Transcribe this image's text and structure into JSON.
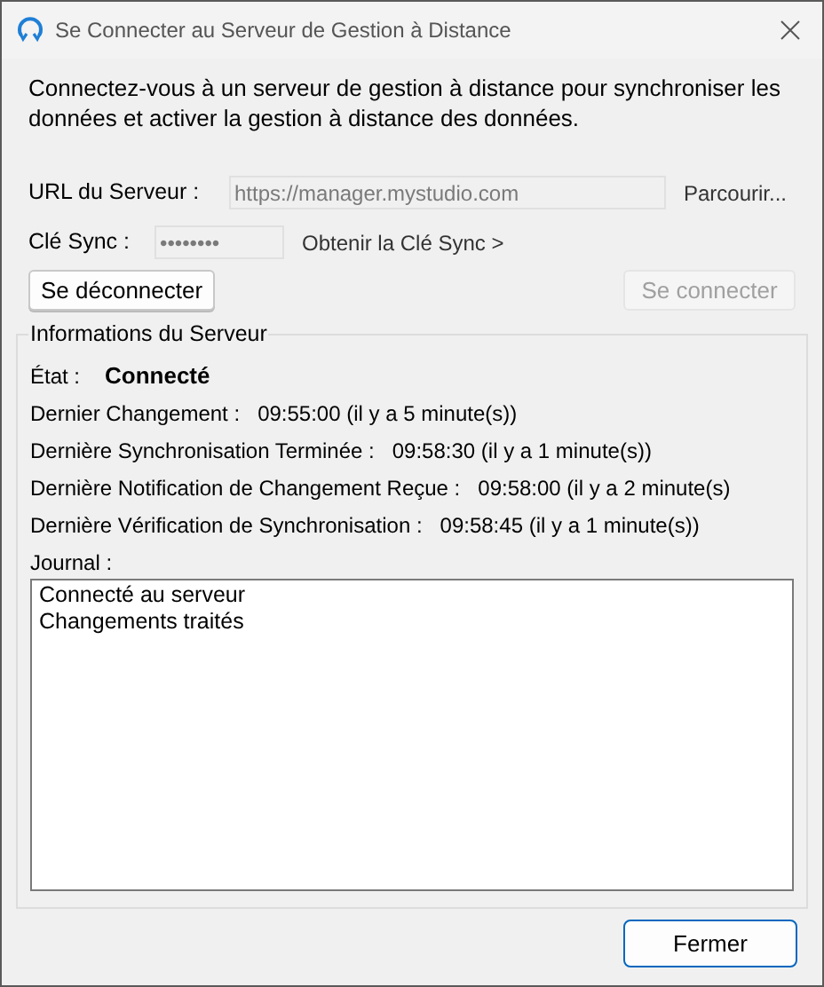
{
  "window": {
    "title": "Se Connecter au Serveur de Gestion à Distance"
  },
  "description": "Connectez-vous à un serveur de gestion à distance pour synchroniser les données et activer la gestion à distance des données.",
  "server_url": {
    "label": "URL du Serveur :",
    "value": "https://manager.mystudio.com",
    "disabled": true
  },
  "browse_link": "Parcourir...",
  "sync_key": {
    "label": "Clé Sync :",
    "value": "••••••••",
    "disabled": true
  },
  "get_key_link": "Obtenir la Clé Sync >",
  "buttons": [
    {
      "label": "Se déconnecter",
      "disabled": false
    },
    {
      "label": "Se connecter",
      "disabled": true
    }
  ],
  "server_info": {
    "title": "Informations du Serveur",
    "status_label": "État :",
    "status": "Connecté",
    "rows": [
      {
        "label": "Dernier Changement :",
        "value": "09:55:00 (il y a 5 minute(s))"
      },
      {
        "label": "Dernière Synchronisation Terminée :",
        "value": "09:58:30 (il y a 1 minute(s))"
      },
      {
        "label": "Dernière Notification de Changement Reçue :",
        "value": "09:58:00 (il y a 2 minute(s)"
      },
      {
        "label": "Dernière Vérification de Synchronisation :",
        "value": "09:58:45 (il y a 1 minute(s))"
      }
    ],
    "log_label": "Journal :",
    "log": [
      "Connecté au serveur",
      "Changements traités"
    ]
  },
  "close_button": {
    "label": "Fermer",
    "default": true
  }
}
